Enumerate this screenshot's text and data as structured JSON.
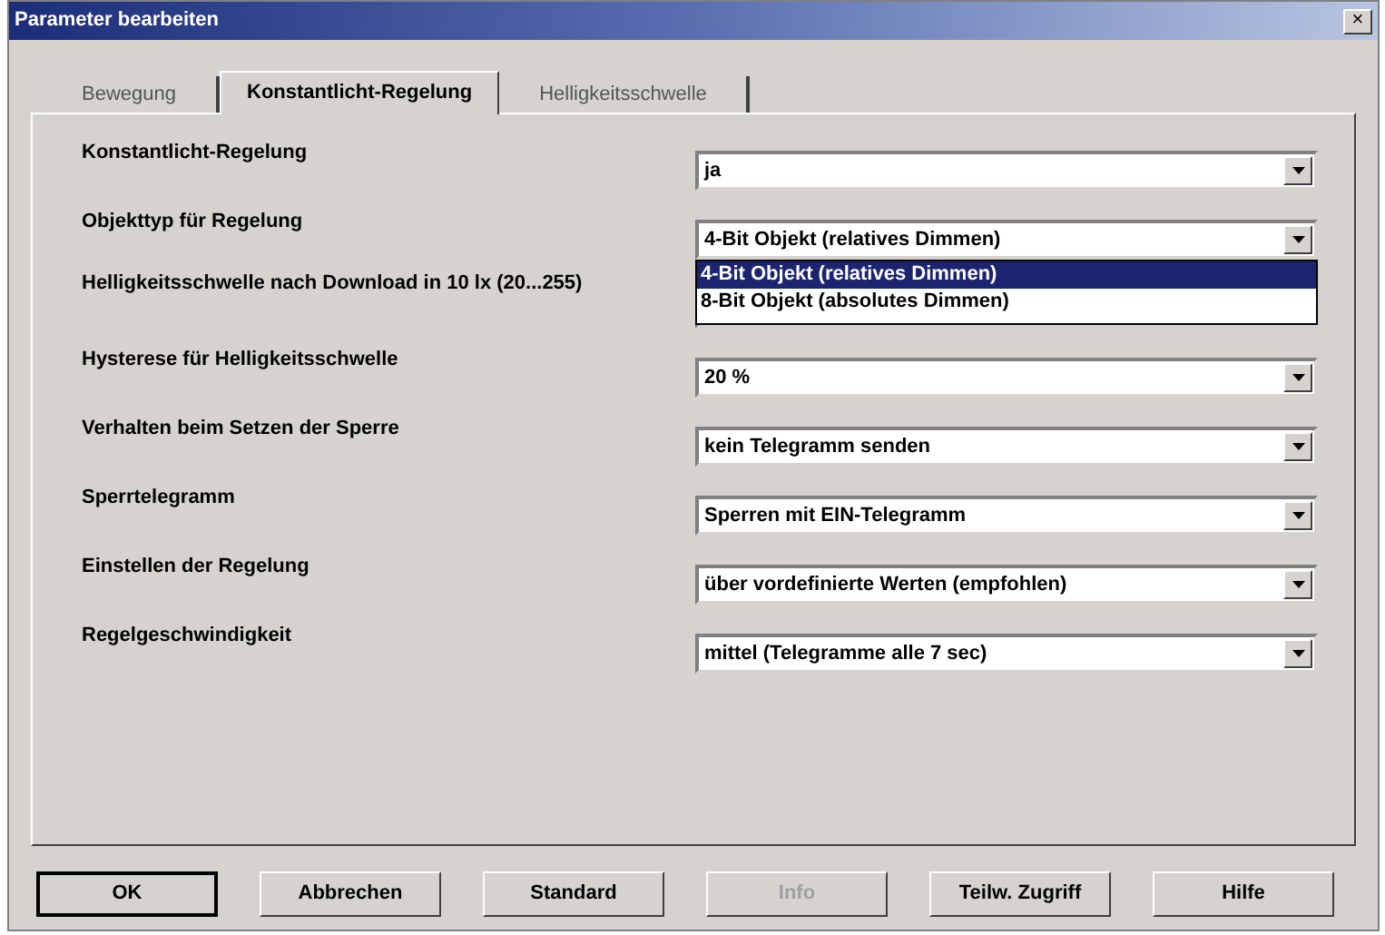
{
  "window": {
    "title": "Parameter bearbeiten",
    "close": "×"
  },
  "tabs": [
    {
      "label": "Bewegung",
      "selected": false
    },
    {
      "label": "Konstantlicht-Regelung",
      "selected": true
    },
    {
      "label": "Helligkeitsschwelle",
      "selected": false
    }
  ],
  "parameters": [
    {
      "label": "Konstantlicht-Regelung",
      "value": "ja"
    },
    {
      "label": "Objekttyp für Regelung",
      "value": "4-Bit Objekt (relatives Dimmen)",
      "open_list": [
        {
          "text": "4-Bit Objekt (relatives Dimmen)",
          "selected": true
        },
        {
          "text": "8-Bit Objekt (absolutes Dimmen)",
          "selected": false
        }
      ]
    },
    {
      "label": "Helligkeitsschwelle nach Download in 10 lx (20...255)"
    },
    {
      "label": "Hysterese für Helligkeitsschwelle",
      "value": "20 %"
    },
    {
      "label": "Verhalten beim Setzen der Sperre",
      "value": "kein Telegramm senden"
    },
    {
      "label": "Sperrtelegramm",
      "value": "Sperren mit EIN-Telegramm"
    },
    {
      "label": "Einstellen der Regelung",
      "value": "über vordefinierte Werten (empfohlen)"
    },
    {
      "label": "Regelgeschwindigkeit",
      "value": "mittel (Telegramme alle 7 sec)"
    }
  ],
  "buttons": [
    {
      "label": "OK",
      "default": true,
      "disabled": false
    },
    {
      "label": "Abbrechen",
      "default": false,
      "disabled": false
    },
    {
      "label": "Standard",
      "default": false,
      "disabled": false
    },
    {
      "label": "Info",
      "default": false,
      "disabled": true
    },
    {
      "label": "Teilw. Zugriff",
      "default": false,
      "disabled": false
    },
    {
      "label": "Hilfe",
      "default": false,
      "disabled": false
    }
  ]
}
